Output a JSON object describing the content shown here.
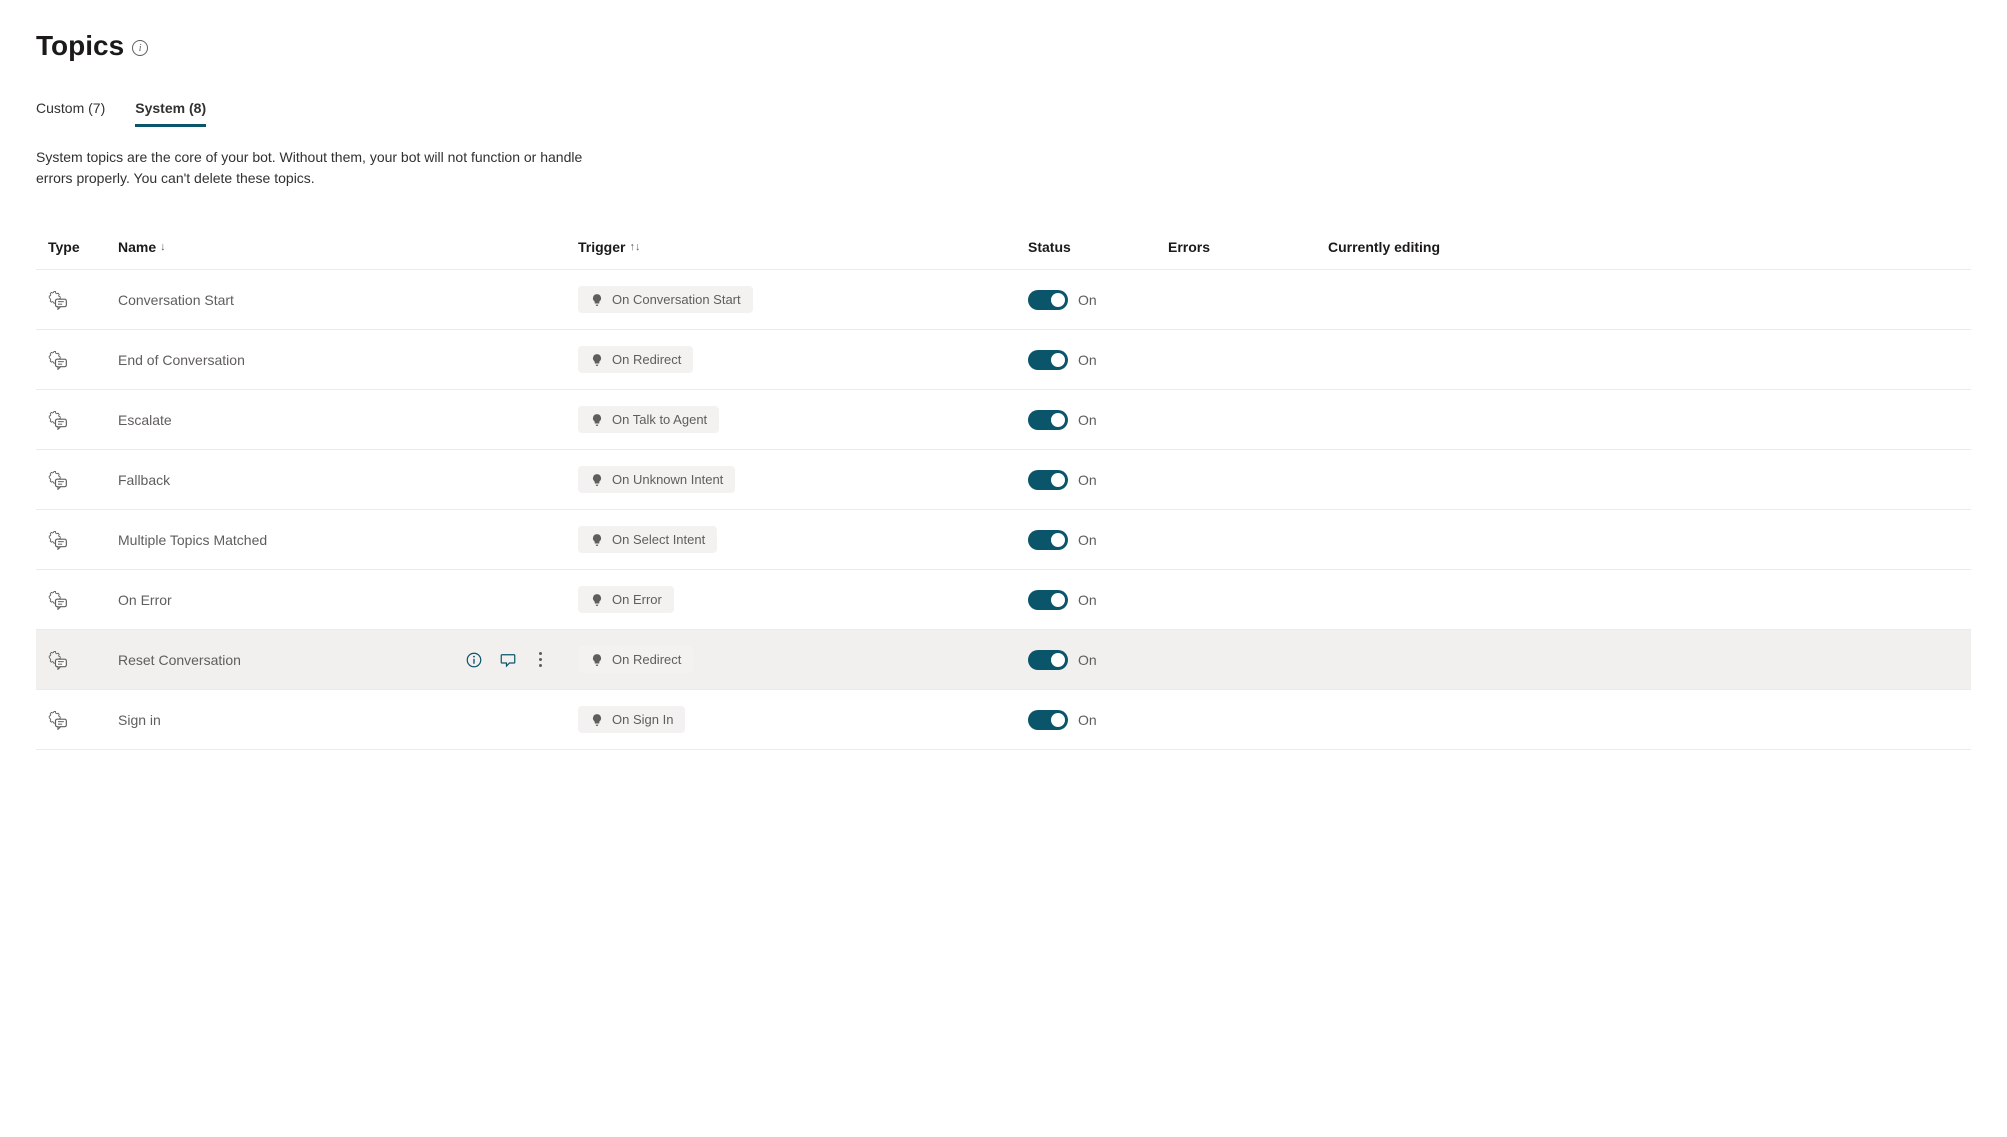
{
  "header": {
    "title": "Topics"
  },
  "tabs": {
    "custom": {
      "label": "Custom",
      "count": 7
    },
    "system": {
      "label": "System",
      "count": 8
    }
  },
  "description": "System topics are the core of your bot. Without them, your bot will not function or handle errors properly. You can't delete these topics.",
  "columns": {
    "type": "Type",
    "name": "Name",
    "trigger": "Trigger",
    "status": "Status",
    "errors": "Errors",
    "editing": "Currently editing"
  },
  "rows": [
    {
      "name": "Conversation Start",
      "trigger": "On Conversation Start",
      "status": "On",
      "highlighted": false
    },
    {
      "name": "End of Conversation",
      "trigger": "On Redirect",
      "status": "On",
      "highlighted": false
    },
    {
      "name": "Escalate",
      "trigger": "On Talk to Agent",
      "status": "On",
      "highlighted": false
    },
    {
      "name": "Fallback",
      "trigger": "On Unknown Intent",
      "status": "On",
      "highlighted": false
    },
    {
      "name": "Multiple Topics Matched",
      "trigger": "On Select Intent",
      "status": "On",
      "highlighted": false
    },
    {
      "name": "On Error",
      "trigger": "On Error",
      "status": "On",
      "highlighted": false
    },
    {
      "name": "Reset Conversation",
      "trigger": "On Redirect",
      "status": "On",
      "highlighted": true
    },
    {
      "name": "Sign in",
      "trigger": "On Sign In",
      "status": "On",
      "highlighted": false
    }
  ]
}
